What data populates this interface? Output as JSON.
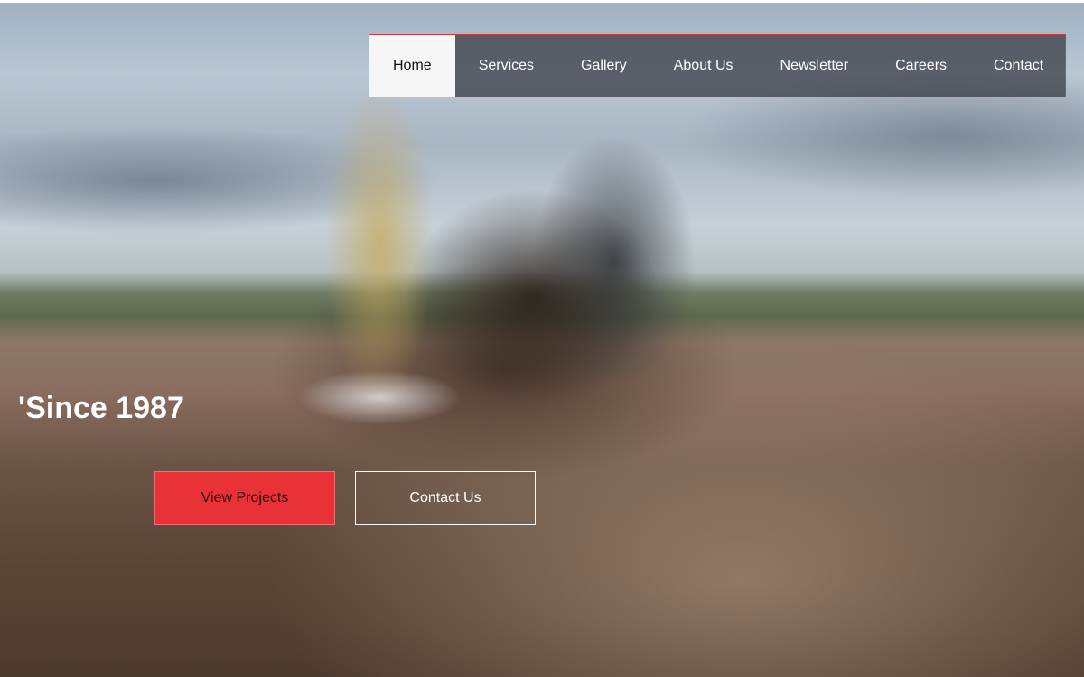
{
  "nav": {
    "items": [
      {
        "label": "Home",
        "active": true
      },
      {
        "label": "Services",
        "active": false
      },
      {
        "label": "Gallery",
        "active": false
      },
      {
        "label": "About Us",
        "active": false
      },
      {
        "label": "Newsletter",
        "active": false
      },
      {
        "label": "Careers",
        "active": false
      },
      {
        "label": "Contact",
        "active": false
      }
    ]
  },
  "hero": {
    "tagline": "'Since 1987",
    "primary_button": "View Projects",
    "secondary_button": "Contact Us"
  },
  "colors": {
    "accent": "#e83238",
    "nav_border": "#d23a3a",
    "nav_active_bg": "#f6f6f6",
    "text_light": "#ffffff"
  }
}
